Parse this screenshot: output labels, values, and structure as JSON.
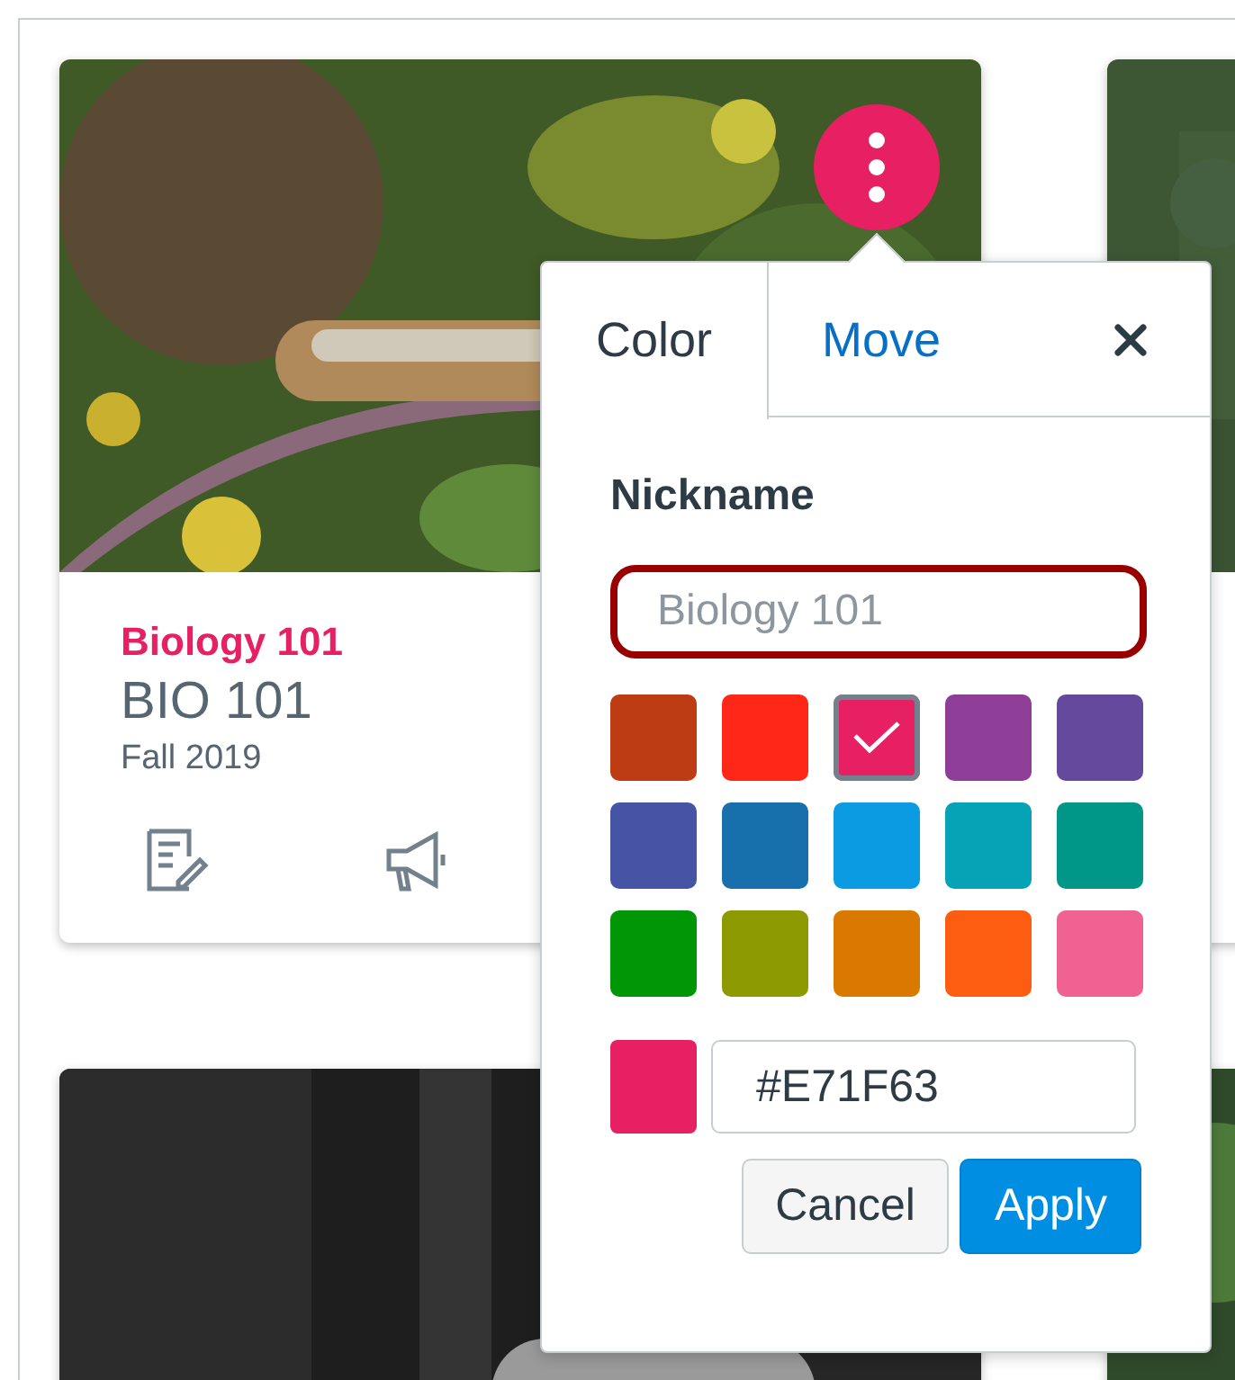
{
  "course_card": {
    "nickname": "Biology 101",
    "code": "BIO 101",
    "term": "Fall 2019"
  },
  "popover": {
    "tabs": [
      {
        "label": "Color",
        "selected": true
      },
      {
        "label": "Move",
        "selected": false
      }
    ],
    "nickname": {
      "label": "Nickname",
      "placeholder": "Biology 101"
    },
    "swatches": [
      {
        "color": "#bd3c14",
        "selected": false
      },
      {
        "color": "#ff2717",
        "selected": false
      },
      {
        "color": "#e71f63",
        "selected": true
      },
      {
        "color": "#8f3e97",
        "selected": false
      },
      {
        "color": "#65499d",
        "selected": false
      },
      {
        "color": "#4554a4",
        "selected": false
      },
      {
        "color": "#1770ab",
        "selected": false
      },
      {
        "color": "#0b9be3",
        "selected": false
      },
      {
        "color": "#06a3b7",
        "selected": false
      },
      {
        "color": "#009688",
        "selected": false
      },
      {
        "color": "#009606",
        "selected": false
      },
      {
        "color": "#8d9900",
        "selected": false
      },
      {
        "color": "#d97900",
        "selected": false
      },
      {
        "color": "#fd5d10",
        "selected": false
      },
      {
        "color": "#f06291",
        "selected": false
      }
    ],
    "custom_color": {
      "color": "#e71f63",
      "value": "#E71F63"
    },
    "buttons": [
      {
        "label": "Cancel",
        "kind": "secondary"
      },
      {
        "label": "Apply",
        "kind": "primary"
      }
    ]
  }
}
